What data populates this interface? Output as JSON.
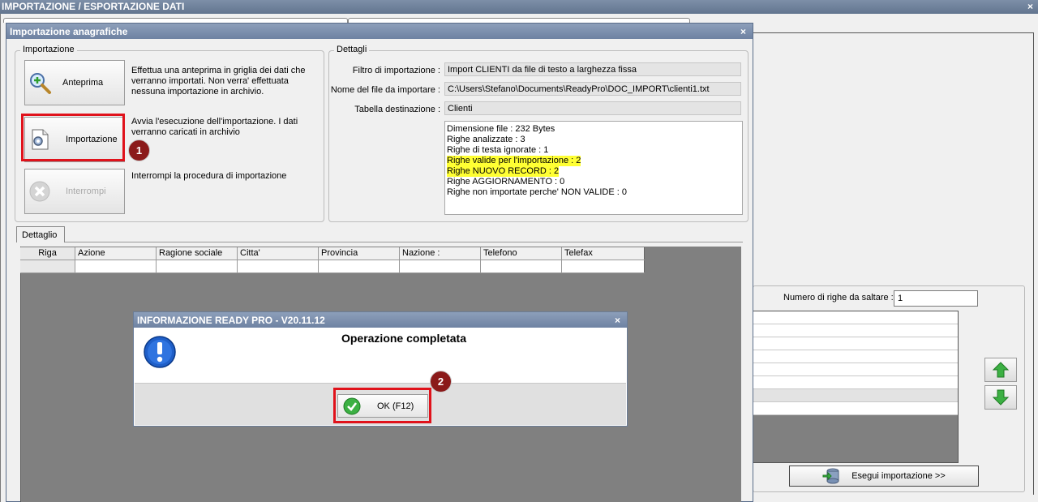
{
  "outer_window": {
    "title": "IMPORTAZIONE / ESPORTAZIONE DATI",
    "close_glyph": "×"
  },
  "background": {
    "skip_rows_label": "Numero di righe da saltare  :",
    "skip_rows_value": "1",
    "execute_button": "Esegui importazione >>"
  },
  "window": {
    "title": "Importazione anagrafiche",
    "close_glyph": "×"
  },
  "import_group": {
    "title": "Importazione",
    "preview_button": "Anteprima",
    "preview_desc": "Effettua una anteprima in griglia dei dati che verranno importati. Non verra' effettuata nessuna importazione in archivio.",
    "import_button": "Importazione",
    "import_desc": "Avvia l'esecuzione dell'importazione. I dati verranno caricati in archivio",
    "stop_button": "Interrompi",
    "stop_desc": "Interrompi la procedura di importazione"
  },
  "details": {
    "title": "Dettagli",
    "filter_label": "Filtro di importazione :",
    "filter_value": "Import CLIENTI da file di testo a larghezza fissa",
    "file_label": "Nome del file da importare :",
    "file_value": "C:\\Users\\Stefano\\Documents\\ReadyPro\\DOC_IMPORT\\clienti1.txt",
    "table_label": "Tabella destinazione :",
    "table_value": "Clienti",
    "log": [
      "Dimensione file : 232 Bytes",
      "Righe analizzate : 3",
      "Righe di testa ignorate : 1",
      "Righe valide per l'importazione : 2",
      "Righe NUOVO RECORD : 2",
      "Righe AGGIORNAMENTO  : 0",
      "Righe non importate perche' NON VALIDE : 0"
    ]
  },
  "tabs": {
    "detail": "Dettaglio"
  },
  "grid": {
    "columns": [
      "Riga",
      "Azione",
      "Ragione sociale",
      "Citta'",
      "Provincia",
      "Nazione :",
      "Telefono",
      "Telefax"
    ]
  },
  "dialog": {
    "title": "INFORMAZIONE READY PRO - V20.11.12",
    "close_glyph": "×",
    "message": "Operazione completata",
    "ok_button": "OK (F12)"
  },
  "annotations": {
    "badge1": "1",
    "badge2": "2"
  },
  "colors": {
    "highlight": "#ffff33",
    "annotation_red": "#e0121b",
    "badge": "#8b1a1a",
    "title_bar": "#7a8dab"
  }
}
